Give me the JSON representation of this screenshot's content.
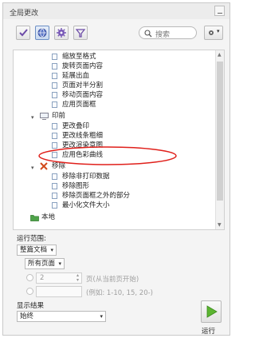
{
  "window": {
    "title": "全局更改"
  },
  "toolbar": {
    "search_placeholder": "搜索"
  },
  "tree": {
    "items": [
      {
        "label": "缩放至格式"
      },
      {
        "label": "旋转页面内容"
      },
      {
        "label": "延展出血"
      },
      {
        "label": "页面对半分割"
      },
      {
        "label": "移动页面内容"
      },
      {
        "label": "应用页面框"
      },
      {
        "label": "印前"
      },
      {
        "label": "更改叠印"
      },
      {
        "label": "更改线条粗细"
      },
      {
        "label": "更改渲染意图"
      },
      {
        "label": "应用色彩曲线"
      },
      {
        "label": "移除"
      },
      {
        "label": "移除非打印数据"
      },
      {
        "label": "移除图形"
      },
      {
        "label": "移除页面框之外的部分"
      },
      {
        "label": "最小化文件大小"
      },
      {
        "label": "本地"
      }
    ],
    "highlight_color": "#e0201b"
  },
  "range": {
    "section_label": "运行范围:",
    "scope_value": "整篇文档",
    "pages_value": "所有页面",
    "page_number_value": "2",
    "page_suffix": "页(从当前页开始)",
    "example_hint": "(例如: 1-10, 15, 20-)"
  },
  "results": {
    "section_label": "显示结果",
    "value": "始终"
  },
  "run": {
    "label": "运行"
  }
}
